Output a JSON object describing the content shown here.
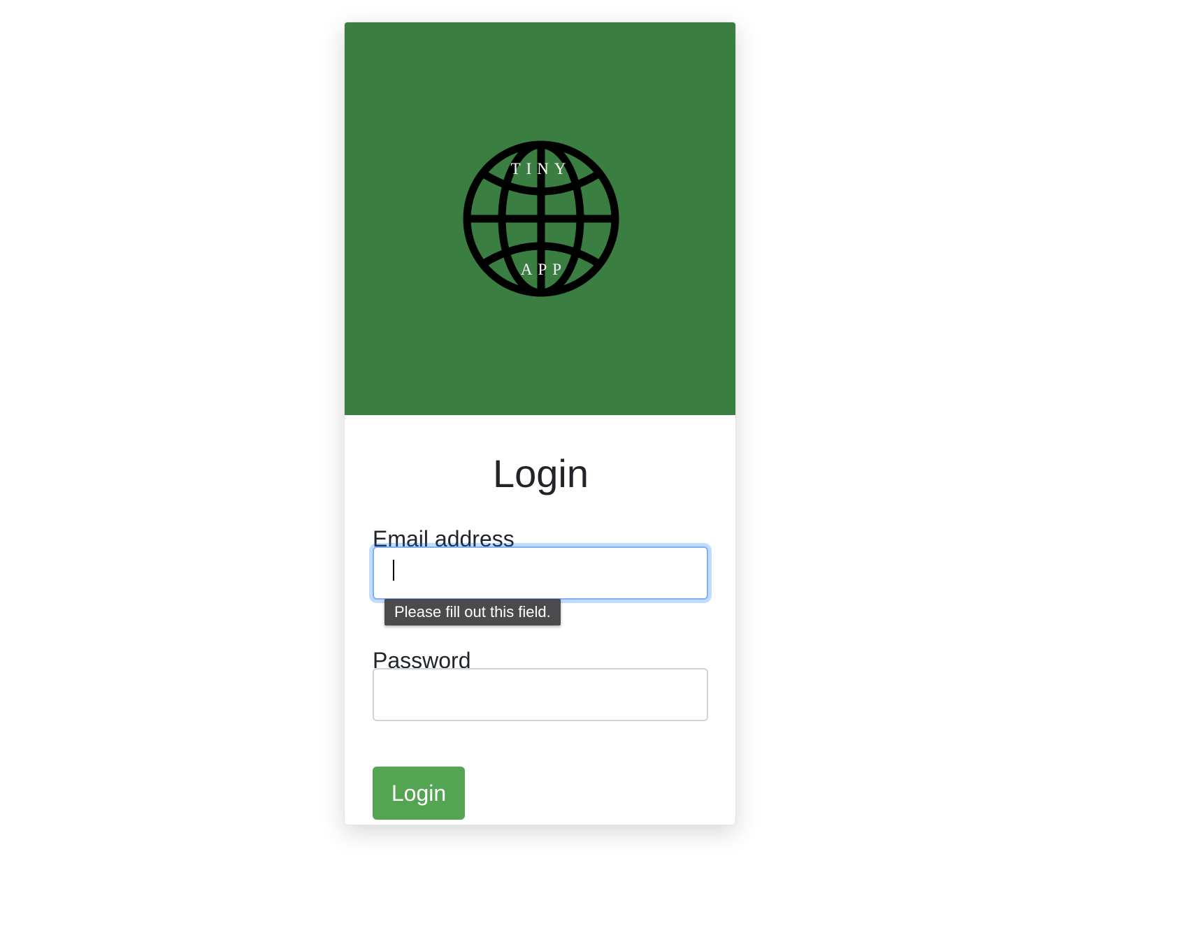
{
  "logo": {
    "icon": "globe-icon",
    "top_text": "TINY",
    "bottom_text": "APP",
    "banner_color": "#3a7f41"
  },
  "form": {
    "title": "Login",
    "email": {
      "label": "Email address",
      "value": "",
      "placeholder": "",
      "validation_message": "Please fill out this field."
    },
    "password": {
      "label": "Password",
      "value": "",
      "placeholder": ""
    },
    "submit_label": "Login",
    "submit_color": "#53a552"
  }
}
